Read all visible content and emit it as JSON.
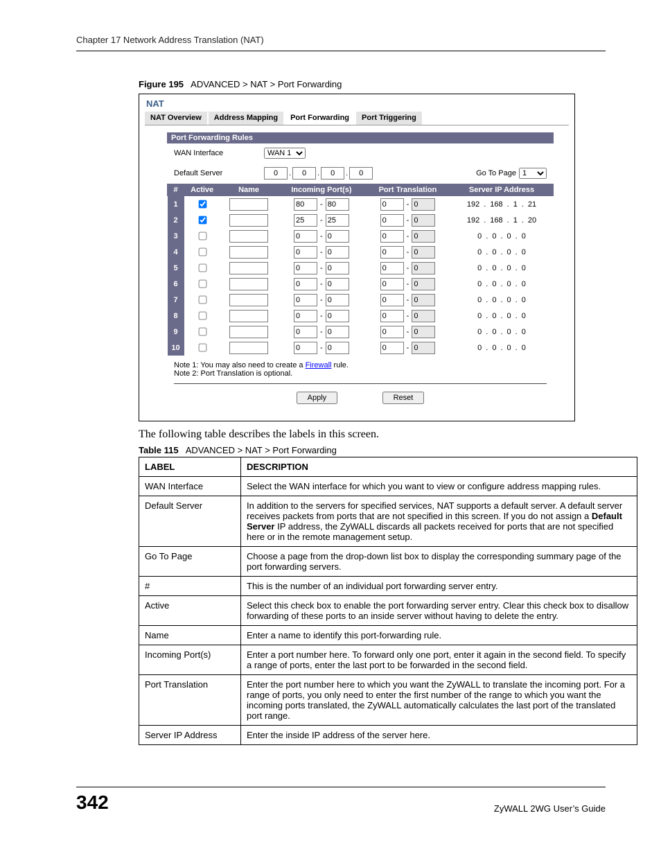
{
  "header": "Chapter 17 Network Address Translation (NAT)",
  "figure": {
    "label": "Figure 195",
    "title": "ADVANCED > NAT > Port Forwarding"
  },
  "nat": {
    "title": "NAT",
    "tabs": [
      "NAT Overview",
      "Address Mapping",
      "Port Forwarding",
      "Port Triggering"
    ],
    "active_tab": 2,
    "section": "Port Forwarding Rules",
    "wan_label": "WAN Interface",
    "wan_value": "WAN 1",
    "default_server_label": "Default Server",
    "default_server_ip": [
      "0",
      "0",
      "0",
      "0"
    ],
    "go_to_page_label": "Go To Page",
    "go_to_page_value": "1",
    "cols": [
      "#",
      "Active",
      "Name",
      "Incoming Port(s)",
      "Port Translation",
      "Server IP Address"
    ],
    "rows": [
      {
        "n": "1",
        "active": true,
        "name": "",
        "in": [
          "80",
          "80"
        ],
        "pt": [
          "0",
          "0"
        ],
        "ip": [
          "192",
          "168",
          "1",
          "21"
        ]
      },
      {
        "n": "2",
        "active": true,
        "name": "",
        "in": [
          "25",
          "25"
        ],
        "pt": [
          "0",
          "0"
        ],
        "ip": [
          "192",
          "168",
          "1",
          "20"
        ]
      },
      {
        "n": "3",
        "active": false,
        "name": "",
        "in": [
          "0",
          "0"
        ],
        "pt": [
          "0",
          "0"
        ],
        "ip": [
          "0",
          "0",
          "0",
          "0"
        ]
      },
      {
        "n": "4",
        "active": false,
        "name": "",
        "in": [
          "0",
          "0"
        ],
        "pt": [
          "0",
          "0"
        ],
        "ip": [
          "0",
          "0",
          "0",
          "0"
        ]
      },
      {
        "n": "5",
        "active": false,
        "name": "",
        "in": [
          "0",
          "0"
        ],
        "pt": [
          "0",
          "0"
        ],
        "ip": [
          "0",
          "0",
          "0",
          "0"
        ]
      },
      {
        "n": "6",
        "active": false,
        "name": "",
        "in": [
          "0",
          "0"
        ],
        "pt": [
          "0",
          "0"
        ],
        "ip": [
          "0",
          "0",
          "0",
          "0"
        ]
      },
      {
        "n": "7",
        "active": false,
        "name": "",
        "in": [
          "0",
          "0"
        ],
        "pt": [
          "0",
          "0"
        ],
        "ip": [
          "0",
          "0",
          "0",
          "0"
        ]
      },
      {
        "n": "8",
        "active": false,
        "name": "",
        "in": [
          "0",
          "0"
        ],
        "pt": [
          "0",
          "0"
        ],
        "ip": [
          "0",
          "0",
          "0",
          "0"
        ]
      },
      {
        "n": "9",
        "active": false,
        "name": "",
        "in": [
          "0",
          "0"
        ],
        "pt": [
          "0",
          "0"
        ],
        "ip": [
          "0",
          "0",
          "0",
          "0"
        ]
      },
      {
        "n": "10",
        "active": false,
        "name": "",
        "in": [
          "0",
          "0"
        ],
        "pt": [
          "0",
          "0"
        ],
        "ip": [
          "0",
          "0",
          "0",
          "0"
        ]
      }
    ],
    "note1_pre": "Note 1: You may also need to create a ",
    "note1_link": "Firewall",
    "note1_post": " rule.",
    "note2": "Note 2: Port Translation is optional.",
    "apply": "Apply",
    "reset": "Reset"
  },
  "body_text": "The following table describes the labels in this screen.",
  "tbl_caption": {
    "label": "Table 115",
    "title": "ADVANCED > NAT > Port Forwarding"
  },
  "desc": {
    "h1": "LABEL",
    "h2": "DESCRIPTION",
    "rows": [
      {
        "l": "WAN Interface",
        "d": "Select the WAN interface for which you want to view or configure address mapping rules."
      },
      {
        "l": "Default Server",
        "d": "In addition to the servers for specified services, NAT supports a default server. A default server receives packets from ports that are not specified in this screen. If you do not assign a Default Server IP address, the ZyWALL discards all packets received for ports that are not specified here or in the remote management setup."
      },
      {
        "l": "Go To Page",
        "d": "Choose a page from the drop-down list box to display the corresponding summary page of the port forwarding servers."
      },
      {
        "l": "#",
        "d": "This is the number of an individual port forwarding server entry."
      },
      {
        "l": "Active",
        "d": "Select this check box to enable the port forwarding server entry. Clear this check box to disallow forwarding of these ports to an inside server without having to delete the entry."
      },
      {
        "l": "Name",
        "d": "Enter a name to identify this port-forwarding rule."
      },
      {
        "l": "Incoming Port(s)",
        "d": "Enter a port number here. To forward only one port, enter it again in the second field. To specify a range of ports, enter the last port to be forwarded in the second field."
      },
      {
        "l": "Port Translation",
        "d": "Enter the port number here to which you want the ZyWALL to translate the incoming port. For a range of ports, you only need to enter the first number of the range to which you want the incoming ports translated, the ZyWALL automatically calculates the last port of the translated port range."
      },
      {
        "l": "Server IP Address",
        "d": "Enter the inside IP address of the server here."
      }
    ]
  },
  "footer": {
    "page": "342",
    "guide": "ZyWALL 2WG User’s Guide"
  }
}
